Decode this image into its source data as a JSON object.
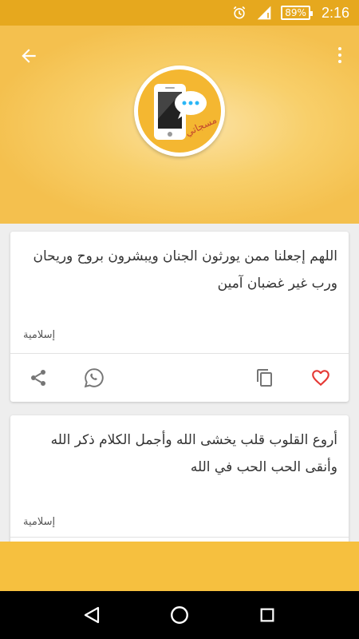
{
  "status_bar": {
    "battery": "89%",
    "time": "2:16",
    "icons": [
      "alarm-icon",
      "signal-icon",
      "battery-icon"
    ]
  },
  "header": {
    "back_icon": "arrow-left-icon",
    "menu_icon": "more-vert-icon",
    "logo_icon": "phone-chat-logo",
    "logo_text": "مسجاتي"
  },
  "cards": [
    {
      "text": "اللهم إجعلنا ممن يورثون الجنان ويبشرون بروح وريحان ورب غير غضبان آمين",
      "category": "إسلامية",
      "actions": [
        "share-icon",
        "whatsapp-icon",
        "copy-icon",
        "heart-icon"
      ]
    },
    {
      "text": "أروع القلوب قلب يخشى الله وأجمل الكلام ذكر الله وأنقى الحب الحب في الله",
      "category": "إسلامية"
    }
  ],
  "colors": {
    "status_bar": "#e6a81e",
    "header": "#f4c04e",
    "accent_red": "#e53935",
    "icon_grey": "#757575",
    "banner": "#f6c03f"
  },
  "nav": {
    "back": "nav-back-icon",
    "home": "nav-home-icon",
    "recents": "nav-recents-icon"
  }
}
